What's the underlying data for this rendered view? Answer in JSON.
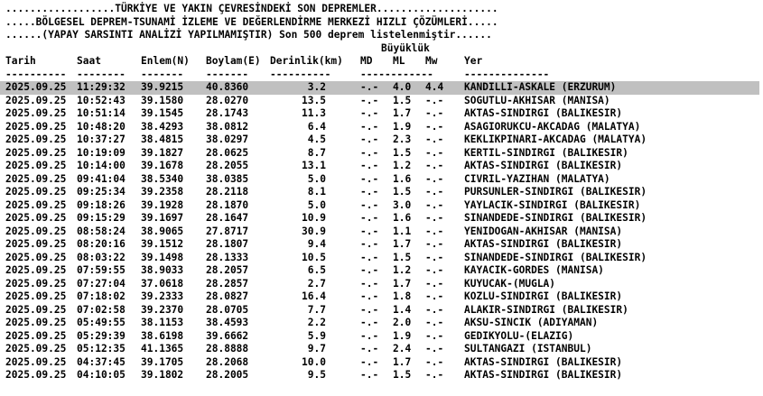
{
  "banner": {
    "line1": "..................TÜRKİYE VE YAKIN ÇEVRESİNDEKİ SON DEPREMLER....................",
    "line2": ".....BÖLGESEL DEPREM-TSUNAMİ İZLEME VE DEĞERLENDİRME MERKEZİ HIZLI ÇÖZÜMLERİ.....",
    "line3": "......(YAPAY SARSINTI ANALİZİ YAPILMAMIŞTIR) Son 500 deprem listelenmiştir......"
  },
  "headers": {
    "group": "Büyüklük",
    "tarih": "Tarih",
    "saat": "Saat",
    "enlem": "Enlem(N)",
    "boylam": "Boylam(E)",
    "derinlik": "Derinlik(km)",
    "md": "MD",
    "ml": "ML",
    "mw": "Mw",
    "yer": "Yer"
  },
  "separators": {
    "tarih": "----------",
    "saat": "--------",
    "enlem": "-------",
    "boylam": "-------",
    "derinlik": "----------",
    "mags": "------------",
    "yer": "--------------"
  },
  "rows": [
    {
      "tarih": "2025.09.25",
      "saat": "11:29:32",
      "enlem": "39.9215",
      "boylam": "40.8360",
      "derinlik": "3.2",
      "md": "-.-",
      "ml": "4.0",
      "mw": "4.4",
      "yer": "KANDILLI-ASKALE (ERZURUM)"
    },
    {
      "tarih": "2025.09.25",
      "saat": "10:52:43",
      "enlem": "39.1580",
      "boylam": "28.0270",
      "derinlik": "13.5",
      "md": "-.-",
      "ml": "1.5",
      "mw": "-.-",
      "yer": "SOGUTLU-AKHISAR (MANISA)"
    },
    {
      "tarih": "2025.09.25",
      "saat": "10:51:14",
      "enlem": "39.1545",
      "boylam": "28.1743",
      "derinlik": "11.3",
      "md": "-.-",
      "ml": "1.7",
      "mw": "-.-",
      "yer": "AKTAS-SINDIRGI (BALIKESIR)"
    },
    {
      "tarih": "2025.09.25",
      "saat": "10:48:20",
      "enlem": "38.4293",
      "boylam": "38.0812",
      "derinlik": "6.4",
      "md": "-.-",
      "ml": "1.9",
      "mw": "-.-",
      "yer": "ASAGIORUKCU-AKCADAG (MALATYA)"
    },
    {
      "tarih": "2025.09.25",
      "saat": "10:37:27",
      "enlem": "38.4815",
      "boylam": "38.0297",
      "derinlik": "4.5",
      "md": "-.-",
      "ml": "2.3",
      "mw": "-.-",
      "yer": "KEKLIKPINARI-AKCADAG (MALATYA)"
    },
    {
      "tarih": "2025.09.25",
      "saat": "10:19:09",
      "enlem": "39.1827",
      "boylam": "28.0625",
      "derinlik": "8.7",
      "md": "-.-",
      "ml": "1.5",
      "mw": "-.-",
      "yer": "KERTIL-SINDIRGI (BALIKESIR)"
    },
    {
      "tarih": "2025.09.25",
      "saat": "10:14:00",
      "enlem": "39.1678",
      "boylam": "28.2055",
      "derinlik": "13.1",
      "md": "-.-",
      "ml": "1.2",
      "mw": "-.-",
      "yer": "AKTAS-SINDIRGI (BALIKESIR)"
    },
    {
      "tarih": "2025.09.25",
      "saat": "09:41:04",
      "enlem": "38.5340",
      "boylam": "38.0385",
      "derinlik": "5.0",
      "md": "-.-",
      "ml": "1.6",
      "mw": "-.-",
      "yer": "CIVRIL-YAZIHAN (MALATYA)"
    },
    {
      "tarih": "2025.09.25",
      "saat": "09:25:34",
      "enlem": "39.2358",
      "boylam": "28.2118",
      "derinlik": "8.1",
      "md": "-.-",
      "ml": "1.5",
      "mw": "-.-",
      "yer": "PURSUNLER-SINDIRGI (BALIKESIR)"
    },
    {
      "tarih": "2025.09.25",
      "saat": "09:18:26",
      "enlem": "39.1928",
      "boylam": "28.1870",
      "derinlik": "5.0",
      "md": "-.-",
      "ml": "3.0",
      "mw": "-.-",
      "yer": "YAYLACIK-SINDIRGI (BALIKESIR)"
    },
    {
      "tarih": "2025.09.25",
      "saat": "09:15:29",
      "enlem": "39.1697",
      "boylam": "28.1647",
      "derinlik": "10.9",
      "md": "-.-",
      "ml": "1.6",
      "mw": "-.-",
      "yer": "SINANDEDE-SINDIRGI (BALIKESIR)"
    },
    {
      "tarih": "2025.09.25",
      "saat": "08:58:24",
      "enlem": "38.9065",
      "boylam": "27.8717",
      "derinlik": "30.9",
      "md": "-.-",
      "ml": "1.1",
      "mw": "-.-",
      "yer": "YENIDOGAN-AKHISAR (MANISA)"
    },
    {
      "tarih": "2025.09.25",
      "saat": "08:20:16",
      "enlem": "39.1512",
      "boylam": "28.1807",
      "derinlik": "9.4",
      "md": "-.-",
      "ml": "1.7",
      "mw": "-.-",
      "yer": "AKTAS-SINDIRGI (BALIKESIR)"
    },
    {
      "tarih": "2025.09.25",
      "saat": "08:03:22",
      "enlem": "39.1498",
      "boylam": "28.1333",
      "derinlik": "10.5",
      "md": "-.-",
      "ml": "1.5",
      "mw": "-.-",
      "yer": "SINANDEDE-SINDIRGI (BALIKESIR)"
    },
    {
      "tarih": "2025.09.25",
      "saat": "07:59:55",
      "enlem": "38.9033",
      "boylam": "28.2057",
      "derinlik": "6.5",
      "md": "-.-",
      "ml": "1.2",
      "mw": "-.-",
      "yer": "KAYACIK-GORDES (MANISA)"
    },
    {
      "tarih": "2025.09.25",
      "saat": "07:27:04",
      "enlem": "37.0618",
      "boylam": "28.2857",
      "derinlik": "2.7",
      "md": "-.-",
      "ml": "1.7",
      "mw": "-.-",
      "yer": "KUYUCAK-(MUGLA)"
    },
    {
      "tarih": "2025.09.25",
      "saat": "07:18:02",
      "enlem": "39.2333",
      "boylam": "28.0827",
      "derinlik": "16.4",
      "md": "-.-",
      "ml": "1.8",
      "mw": "-.-",
      "yer": "KOZLU-SINDIRGI (BALIKESIR)"
    },
    {
      "tarih": "2025.09.25",
      "saat": "07:02:58",
      "enlem": "39.2370",
      "boylam": "28.0705",
      "derinlik": "7.7",
      "md": "-.-",
      "ml": "1.4",
      "mw": "-.-",
      "yer": "ALAKIR-SINDIRGI (BALIKESIR)"
    },
    {
      "tarih": "2025.09.25",
      "saat": "05:49:55",
      "enlem": "38.1153",
      "boylam": "38.4593",
      "derinlik": "2.2",
      "md": "-.-",
      "ml": "2.0",
      "mw": "-.-",
      "yer": "AKSU-SINCIK (ADIYAMAN)"
    },
    {
      "tarih": "2025.09.25",
      "saat": "05:29:39",
      "enlem": "38.6198",
      "boylam": "39.6662",
      "derinlik": "5.9",
      "md": "-.-",
      "ml": "1.9",
      "mw": "-.-",
      "yer": "GEDIKYOLU-(ELAZIG)"
    },
    {
      "tarih": "2025.09.25",
      "saat": "05:12:35",
      "enlem": "41.1365",
      "boylam": "28.8888",
      "derinlik": "9.7",
      "md": "-.-",
      "ml": "2.4",
      "mw": "-.-",
      "yer": "SULTANGAZI (ISTANBUL)"
    },
    {
      "tarih": "2025.09.25",
      "saat": "04:37:45",
      "enlem": "39.1705",
      "boylam": "28.2068",
      "derinlik": "10.0",
      "md": "-.-",
      "ml": "1.7",
      "mw": "-.-",
      "yer": "AKTAS-SINDIRGI (BALIKESIR)"
    },
    {
      "tarih": "2025.09.25",
      "saat": "04:10:05",
      "enlem": "39.1802",
      "boylam": "28.2005",
      "derinlik": "9.5",
      "md": "-.-",
      "ml": "1.5",
      "mw": "-.-",
      "yer": "AKTAS-SINDIRGI (BALIKESIR)"
    }
  ],
  "colors": {
    "background": "#ffffff",
    "text": "#000000",
    "highlight_row": "#c0c0c0"
  }
}
